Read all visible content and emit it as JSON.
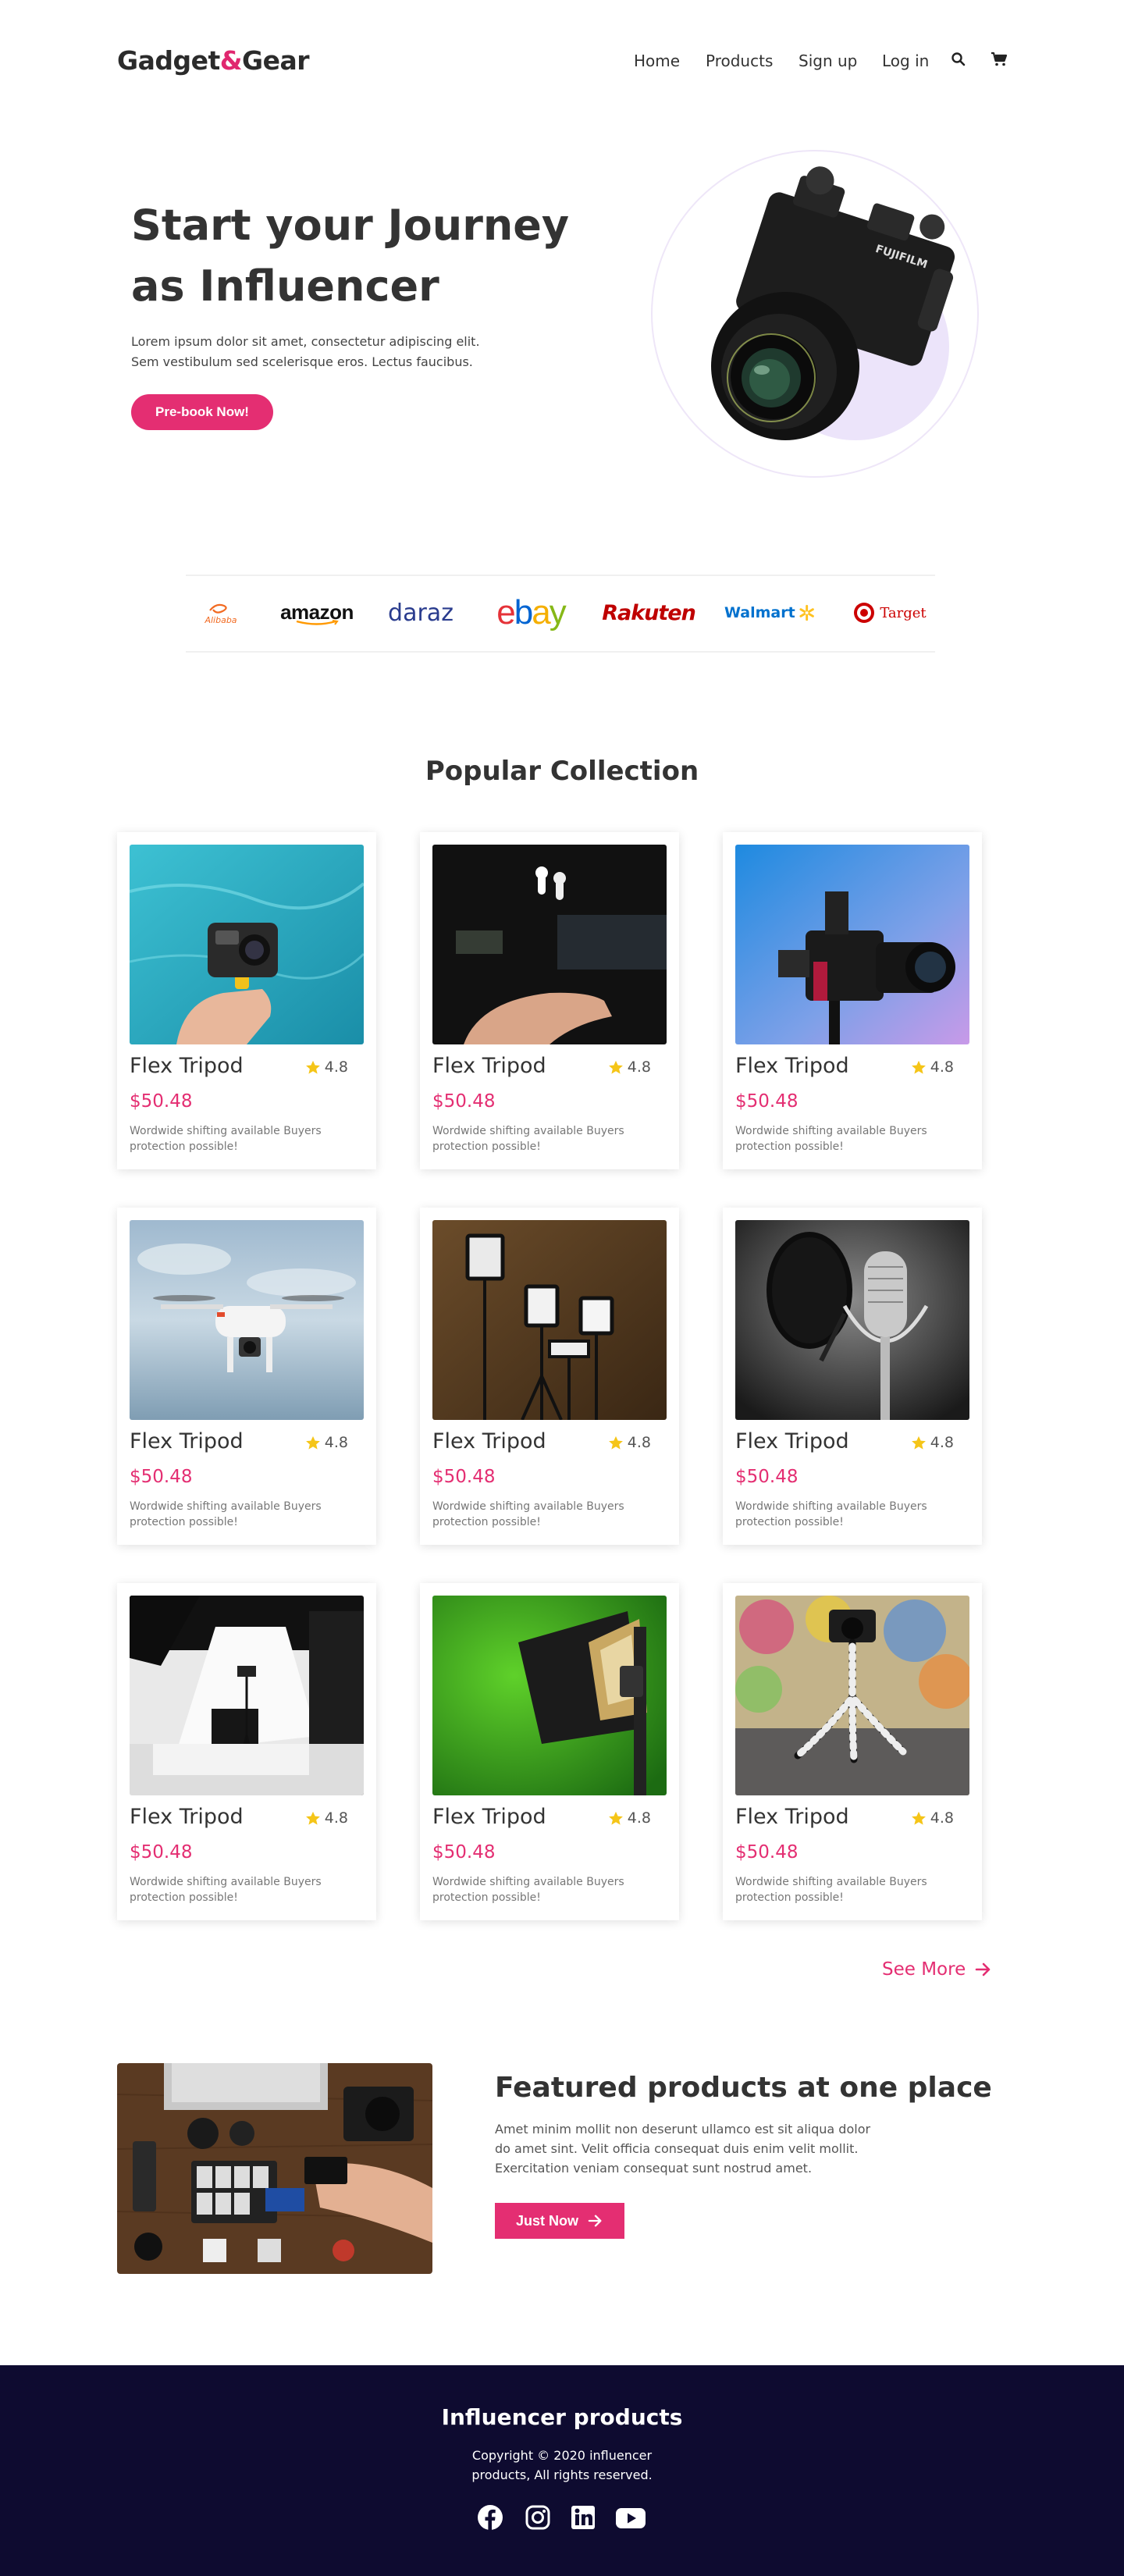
{
  "brand": {
    "name_part1": "Gadget",
    "amp": "&",
    "name_part2": "Gear"
  },
  "nav": {
    "home": "Home",
    "products": "Products",
    "signup": "Sign up",
    "login": "Log in",
    "search_icon": "search-icon",
    "cart_icon": "cart-icon"
  },
  "hero": {
    "title": "Start your Journey as Influencer",
    "text": "Lorem ipsum dolor sit amet, consectetur adipiscing elit. Sem vestibulum sed scelerisque eros. Lectus faucibus.",
    "cta": "Pre-book Now!"
  },
  "partners": {
    "alibaba": "Alibaba",
    "amazon": "amazon",
    "daraz": "daraz",
    "ebay": [
      "e",
      "b",
      "a",
      "y"
    ],
    "rakuten": "Rakuten",
    "walmart": "Walmart",
    "target": "Target"
  },
  "collection": {
    "title": "Popular Collection",
    "products": [
      {
        "name": "Flex Tripod",
        "rating": "4.8",
        "price": "$50.48",
        "desc": "Wordwide shifting available Buyers protection possible!"
      },
      {
        "name": "Flex Tripod",
        "rating": "4.8",
        "price": "$50.48",
        "desc": "Wordwide shifting available Buyers protection possible!"
      },
      {
        "name": "Flex Tripod",
        "rating": "4.8",
        "price": "$50.48",
        "desc": "Wordwide shifting available Buyers protection possible!"
      },
      {
        "name": "Flex Tripod",
        "rating": "4.8",
        "price": "$50.48",
        "desc": "Wordwide shifting available Buyers protection possible!"
      },
      {
        "name": "Flex Tripod",
        "rating": "4.8",
        "price": "$50.48",
        "desc": "Wordwide shifting available Buyers protection possible!"
      },
      {
        "name": "Flex Tripod",
        "rating": "4.8",
        "price": "$50.48",
        "desc": "Wordwide shifting available Buyers protection possible!"
      },
      {
        "name": "Flex Tripod",
        "rating": "4.8",
        "price": "$50.48",
        "desc": "Wordwide shifting available Buyers protection possible!"
      },
      {
        "name": "Flex Tripod",
        "rating": "4.8",
        "price": "$50.48",
        "desc": "Wordwide shifting available Buyers protection possible!"
      },
      {
        "name": "Flex Tripod",
        "rating": "4.8",
        "price": "$50.48",
        "desc": "Wordwide shifting available Buyers protection possible!"
      }
    ],
    "see_more": "See More"
  },
  "featured": {
    "title": "Featured products at one place",
    "text": "Amet minim mollit non deserunt ullamco est sit aliqua dolor do amet sint. Velit officia consequat duis enim velit mollit. Exercitation veniam consequat sunt nostrud amet.",
    "cta": "Just Now"
  },
  "footer": {
    "title": "Influencer products",
    "copyright": "Copyright © 2020 influencer products, All rights reserved.",
    "social": [
      "facebook-icon",
      "instagram-icon",
      "linkedin-icon",
      "youtube-icon"
    ]
  },
  "colors": {
    "accent": "#e42e72",
    "footer_bg": "#0e0b30",
    "star": "#f5c518"
  }
}
